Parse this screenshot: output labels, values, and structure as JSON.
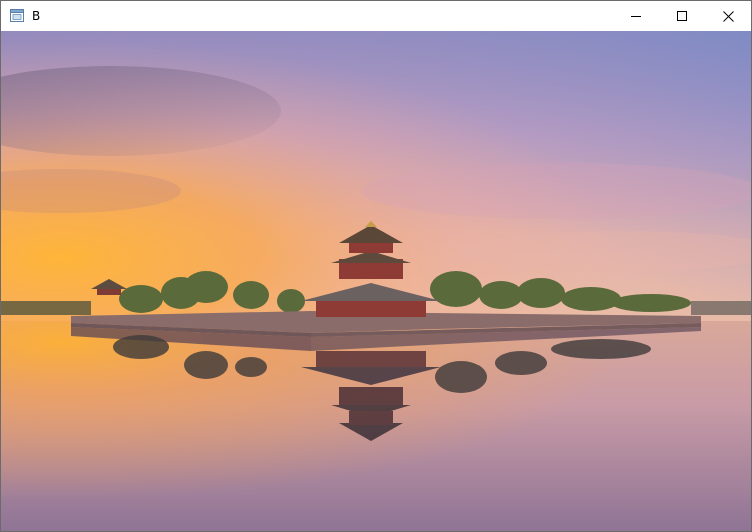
{
  "window": {
    "title": "B"
  },
  "controls": {
    "minimize": "minimize-icon",
    "maximize": "maximize-icon",
    "close": "close-icon"
  },
  "image": {
    "subject": "corner-tower-at-sunset-reflection"
  },
  "colors": {
    "titlebar": "#ffffff",
    "border": "#6b6b6b",
    "sky_orange": "#f6a34a",
    "sky_violet": "#9b8fc2",
    "tower_red": "#8e3b36"
  }
}
